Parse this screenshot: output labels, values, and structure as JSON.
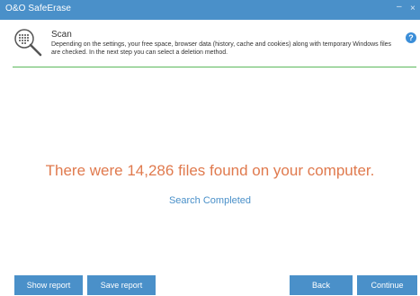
{
  "window": {
    "title": "O&O SafeErase",
    "minimize_glyph": "–",
    "close_glyph": "×"
  },
  "header": {
    "title": "Scan",
    "description": "Depending on the settings, your free space, browser data (history, cache and cookies) along with temporary Windows files are checked. In the next step you can select a deletion method.",
    "help_glyph": "?",
    "icon": "magnifier-scan-icon"
  },
  "main": {
    "result": "There were 14,286 files found on your computer.",
    "status": "Search Completed"
  },
  "footer": {
    "show_report": "Show report",
    "save_report": "Save report",
    "back": "Back",
    "continue": "Continue"
  },
  "colors": {
    "accent": "#4a90c9",
    "result": "#e07a4e",
    "divider": "#5cb85c"
  }
}
